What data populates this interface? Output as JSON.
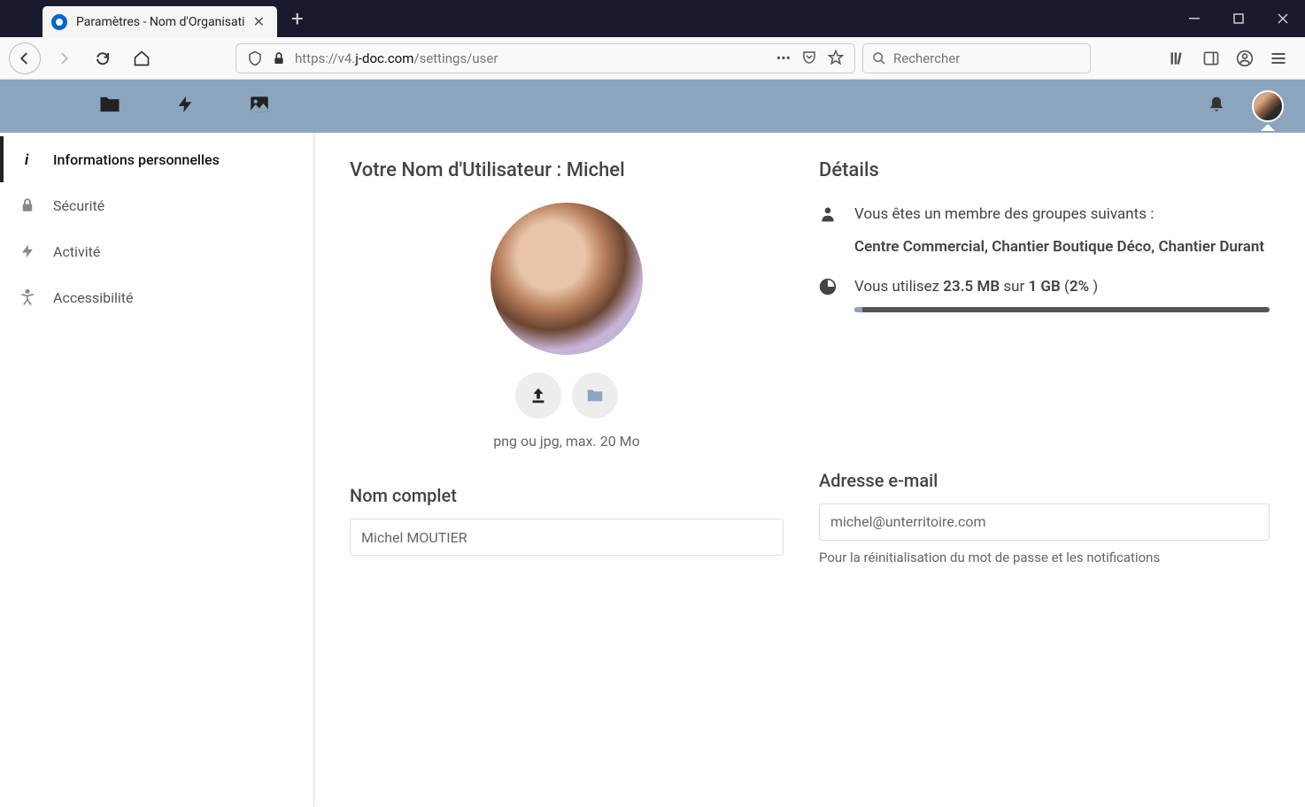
{
  "browser": {
    "tab_title": "Paramètres - Nom d'Organisati",
    "url_prefix": "https://v4.",
    "url_domain": "j-doc.com",
    "url_path": "/settings/user",
    "search_placeholder": "Rechercher"
  },
  "sidebar": {
    "items": [
      {
        "label": "Informations personnelles"
      },
      {
        "label": "Sécurité"
      },
      {
        "label": "Activité"
      },
      {
        "label": "Accessibilité"
      }
    ]
  },
  "main": {
    "heading_prefix": "Votre Nom d'Utilisateur : ",
    "username": "Michel",
    "upload_hint": "png ou jpg, max. 20 Mo",
    "fullname_label": "Nom complet",
    "fullname_value": "Michel MOUTIER",
    "email_label": "Adresse e-mail",
    "email_value": "michel@unterritoire.com",
    "email_hint": "Pour la réinitialisation du mot de passe et les notifications"
  },
  "details": {
    "heading": "Détails",
    "groups_intro": "Vous êtes un membre des groupes suivants :",
    "groups_list": "Centre Commercial, Chantier Boutique Déco, Chantier Durant",
    "usage_prefix": "Vous utilisez ",
    "usage_used": "23.5 MB",
    "usage_mid": " sur ",
    "usage_total": "1 GB",
    "usage_pct_open": " (",
    "usage_pct": "2%",
    "usage_pct_close": " )",
    "progress_pct": 2
  }
}
